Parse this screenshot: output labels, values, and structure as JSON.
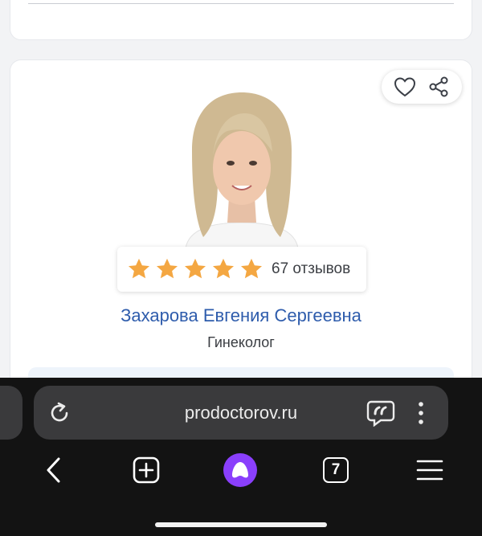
{
  "doctor": {
    "name": "Захарова Евгения Сергеевна",
    "specialty": "Гинеколог",
    "rating_stars": 5,
    "reviews_label": "67 отзывов"
  },
  "browser": {
    "url": "prodoctorov.ru",
    "tab_count": "7"
  },
  "icons": {
    "favorite": "heart-icon",
    "share": "share-icon",
    "reload": "reload-icon",
    "assistant": "quote-bubble-icon",
    "more": "more-vertical-icon",
    "back": "chevron-left-icon",
    "new_tab": "plus-square-icon",
    "alice": "alice-icon",
    "menu": "hamburger-icon"
  },
  "colors": {
    "accent": "#2e5cac",
    "star": "#f4a742",
    "alice": "#8a3ffc"
  }
}
